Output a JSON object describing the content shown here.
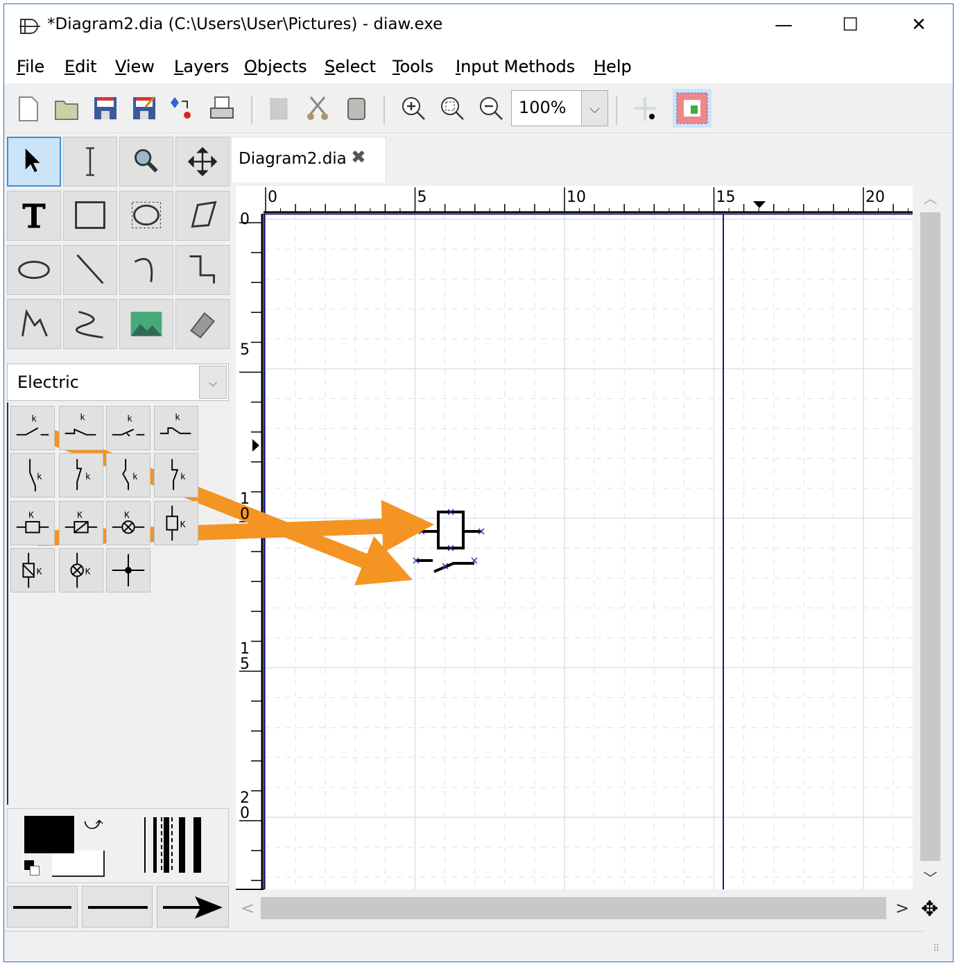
{
  "window": {
    "title": "*Diagram2.dia (C:\\Users\\User\\Pictures) - diaw.exe",
    "minimize": "—",
    "maximize": "☐",
    "close": "✕"
  },
  "menu": [
    {
      "label": "File",
      "key": "F",
      "rest": "ile"
    },
    {
      "label": "Edit",
      "key": "E",
      "rest": "dit"
    },
    {
      "label": "View",
      "key": "V",
      "rest": "iew"
    },
    {
      "label": "Layers",
      "key": "L",
      "rest": "ayers"
    },
    {
      "label": "Objects",
      "key": "O",
      "rest": "bjects"
    },
    {
      "label": "Select",
      "key": "S",
      "rest": "elect"
    },
    {
      "label": "Tools",
      "key": "T",
      "rest": "ools"
    },
    {
      "label": "Input Methods",
      "key": "I",
      "rest": "nput Methods"
    },
    {
      "label": "Help",
      "key": "H",
      "rest": "elp"
    }
  ],
  "toolbar": {
    "zoom_value": "100%",
    "icons": [
      "new-icon",
      "open-icon",
      "save-icon",
      "save-as-icon",
      "export-icon",
      "print-icon",
      "copy-icon",
      "cut-icon",
      "paste-icon",
      "zoom-in-icon",
      "zoom-fit-icon",
      "zoom-out-icon",
      "snap-to-grid-icon",
      "snap-to-objects-icon"
    ]
  },
  "toolbox": {
    "tools": [
      "pointer",
      "text-edit",
      "magnify",
      "scroll",
      "text",
      "box",
      "ellipse",
      "polygon",
      "beziergon",
      "line",
      "arc",
      "zigzag-line",
      "polyline",
      "bezier-line",
      "image",
      "outline"
    ],
    "selected": "pointer"
  },
  "sheet": {
    "selected": "Electric"
  },
  "shapes": [
    "make-contact",
    "make-contact-delayed",
    "make-contact-2",
    "make-contact-3",
    "vertical-contact",
    "vertical-contact-2",
    "vertical-contact-3",
    "vertical-contact-4",
    "relay-coil",
    "relay-coil-2",
    "lamp",
    "relay-coil-vertical",
    "relay-coil-vertical-2",
    "lamp-vertical",
    "connection-point"
  ],
  "shape_label_k": "k",
  "shape_label_K": "K",
  "colors": {
    "foreground": "#000000",
    "background": "#ffffff",
    "accent_arrow": "#f39423",
    "grid": "#d8e4ea",
    "page_border": "#1a1a7a"
  },
  "document": {
    "tab_label": "Diagram2.dia",
    "tab_close": "✖"
  },
  "rulers": {
    "h_labels": [
      "0",
      "5",
      "10",
      "15",
      "20"
    ],
    "v_labels": [
      "0",
      "5",
      "1\n0",
      "1\n5",
      "2\n0"
    ]
  },
  "scroll": {
    "left": "<",
    "right": ">",
    "up": "^",
    "down": "v"
  }
}
